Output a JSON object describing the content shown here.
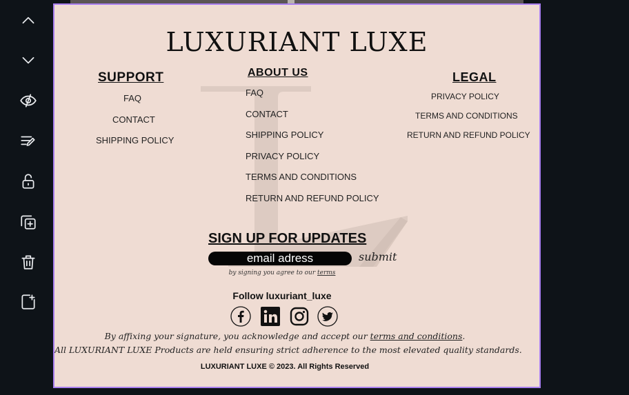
{
  "editor_toolbar": {
    "buttons": [
      {
        "name": "move-up",
        "icon": "chevron-up-icon"
      },
      {
        "name": "move-down",
        "icon": "chevron-down-icon"
      },
      {
        "name": "hide",
        "icon": "eye-slash-icon"
      },
      {
        "name": "edit-notes",
        "icon": "edit-lines-icon"
      },
      {
        "name": "lock",
        "icon": "unlock-icon"
      },
      {
        "name": "duplicate",
        "icon": "duplicate-icon"
      },
      {
        "name": "delete",
        "icon": "trash-icon"
      },
      {
        "name": "add-page",
        "icon": "add-page-icon"
      }
    ]
  },
  "colors": {
    "page_bg": "#efdcd3",
    "selection_border": "#a97ff0",
    "editor_bg": "#0e1318"
  },
  "brand": "LUXURIANT LUXE",
  "support": {
    "heading": "SUPPORT",
    "links": [
      "FAQ",
      "CONTACT",
      "SHIPPING POLICY"
    ]
  },
  "about": {
    "heading": "ABOUT US",
    "links": [
      "FAQ",
      "CONTACT",
      "SHIPPING POLICY",
      "PRIVACY POLICY",
      "TERMS AND CONDITIONS",
      "RETURN AND REFUND POLICY"
    ]
  },
  "legal": {
    "heading": "LEGAL",
    "links": [
      "PRIVACY POLICY",
      "TERMS AND CONDITIONS",
      "RETURN AND REFUND POLICY"
    ]
  },
  "signup": {
    "heading": "SIGN UP FOR UPDATES",
    "email_value": "email adress",
    "submit_label": "submit",
    "agree_prefix": "by signing you agree to our ",
    "agree_terms": "terms"
  },
  "follow": "Follow luxuriant_luxe",
  "social_icons": [
    "facebook-icon",
    "linkedin-icon",
    "instagram-icon",
    "twitter-icon"
  ],
  "notice": {
    "line1_prefix": "By affixing your signature, you acknowledge and accept our ",
    "line1_link": "terms and conditions",
    "line1_suffix": ".",
    "line2": "All LUXURIANT LUXE Products are held ensuring strict adherence to the most elevated quality standards."
  },
  "copyright": "LUXURIANT LUXE © 2023. All Rights Reserved"
}
